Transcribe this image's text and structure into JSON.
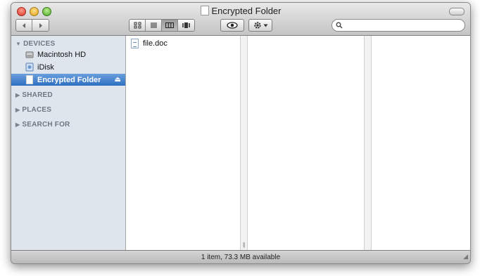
{
  "window": {
    "title": "Encrypted Folder"
  },
  "toolbar": {
    "back_icon": "back-arrow-icon",
    "forward_icon": "forward-arrow-icon",
    "view_modes": [
      "icon-view-icon",
      "list-view-icon",
      "column-view-icon",
      "coverflow-view-icon"
    ],
    "active_view": "column-view",
    "search": {
      "value": "",
      "placeholder": ""
    }
  },
  "sidebar": {
    "sections": {
      "devices": "DEVICES",
      "shared": "SHARED",
      "places": "PLACES",
      "search_for": "SEARCH FOR"
    },
    "devices": [
      {
        "label": "Macintosh HD",
        "icon": "hard-drive-icon"
      },
      {
        "label": "iDisk",
        "icon": "idisk-icon"
      },
      {
        "label": "Encrypted Folder",
        "icon": "disk-image-icon",
        "selected": true,
        "eject": "⏏"
      }
    ]
  },
  "browser": {
    "columns": [
      {
        "items": [
          {
            "label": "file.doc",
            "icon": "document-icon"
          }
        ]
      },
      {
        "items": []
      },
      {
        "items": []
      }
    ]
  },
  "status_bar": {
    "text": "1 item, 73.3 MB available"
  },
  "colors": {
    "selection": "#2f6fc2",
    "sidebar_bg": "#dfe5ed"
  }
}
